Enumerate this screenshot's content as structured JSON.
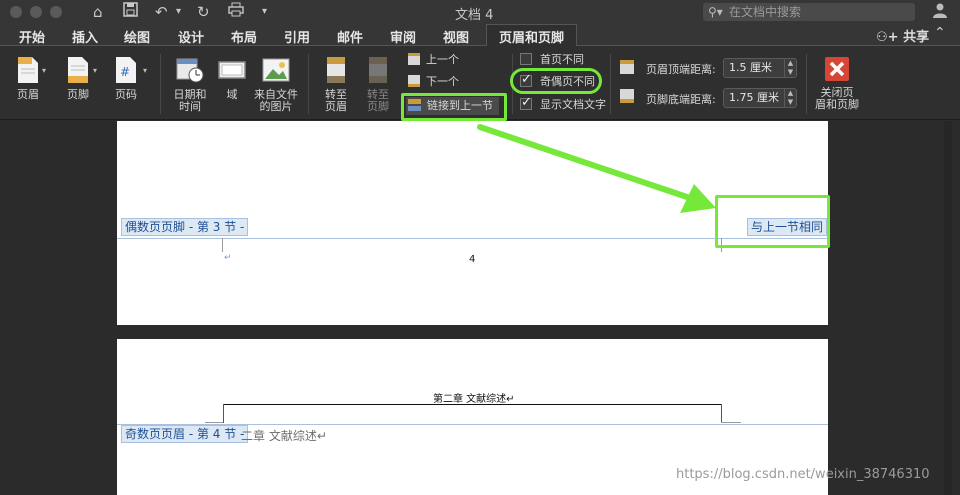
{
  "window": {
    "title": "文档 4"
  },
  "search": {
    "placeholder": "在文档中搜索"
  },
  "tabs": [
    "开始",
    "插入",
    "绘图",
    "设计",
    "布局",
    "引用",
    "邮件",
    "审阅",
    "视图",
    "页眉和页脚"
  ],
  "active_tab": "页眉和页脚",
  "share_label": "共享",
  "ribbon": {
    "header": "页眉",
    "footer": "页脚",
    "page_number": "页码",
    "date_time_1": "日期和",
    "date_time_2": "时间",
    "field": "域",
    "picture_1": "来自文件",
    "picture_2": "的图片",
    "goto_header_1": "转至",
    "goto_header_2": "页眉",
    "goto_footer_1": "转至",
    "goto_footer_2": "页脚",
    "previous": "上一个",
    "next": "下一个",
    "link_previous": "链接到上一节",
    "different_first": "首页不同",
    "different_odd_even": "奇偶页不同",
    "show_doc_text": "显示文档文字",
    "header_top_label": "页眉顶端距离:",
    "header_top_value": "1.5 厘米",
    "footer_bottom_label": "页脚底端距离:",
    "footer_bottom_value": "1.75 厘米",
    "close_1": "关闭页",
    "close_2": "眉和页脚"
  },
  "checkbox_state": {
    "different_first": false,
    "different_odd_even": true,
    "show_doc_text": true
  },
  "page1": {
    "footer_tag": "偶数页页脚 - 第 3 节 -",
    "same_as_previous": "与上一节相同",
    "page_number": "4",
    "para_mark": "↵"
  },
  "page2": {
    "header_text": "第二章  文献综述↵",
    "header_tag": "奇数页页眉 - 第 4 节 -",
    "header_body": "二章  文献综述↵"
  },
  "watermark": "https://blog.csdn.net/weixin_38746310",
  "colors": {
    "annotation": "#76e83a",
    "hf_tag_bg": "#dde8f5",
    "hf_tag_text": "#1e4f94",
    "close_icon": "#d64535"
  }
}
